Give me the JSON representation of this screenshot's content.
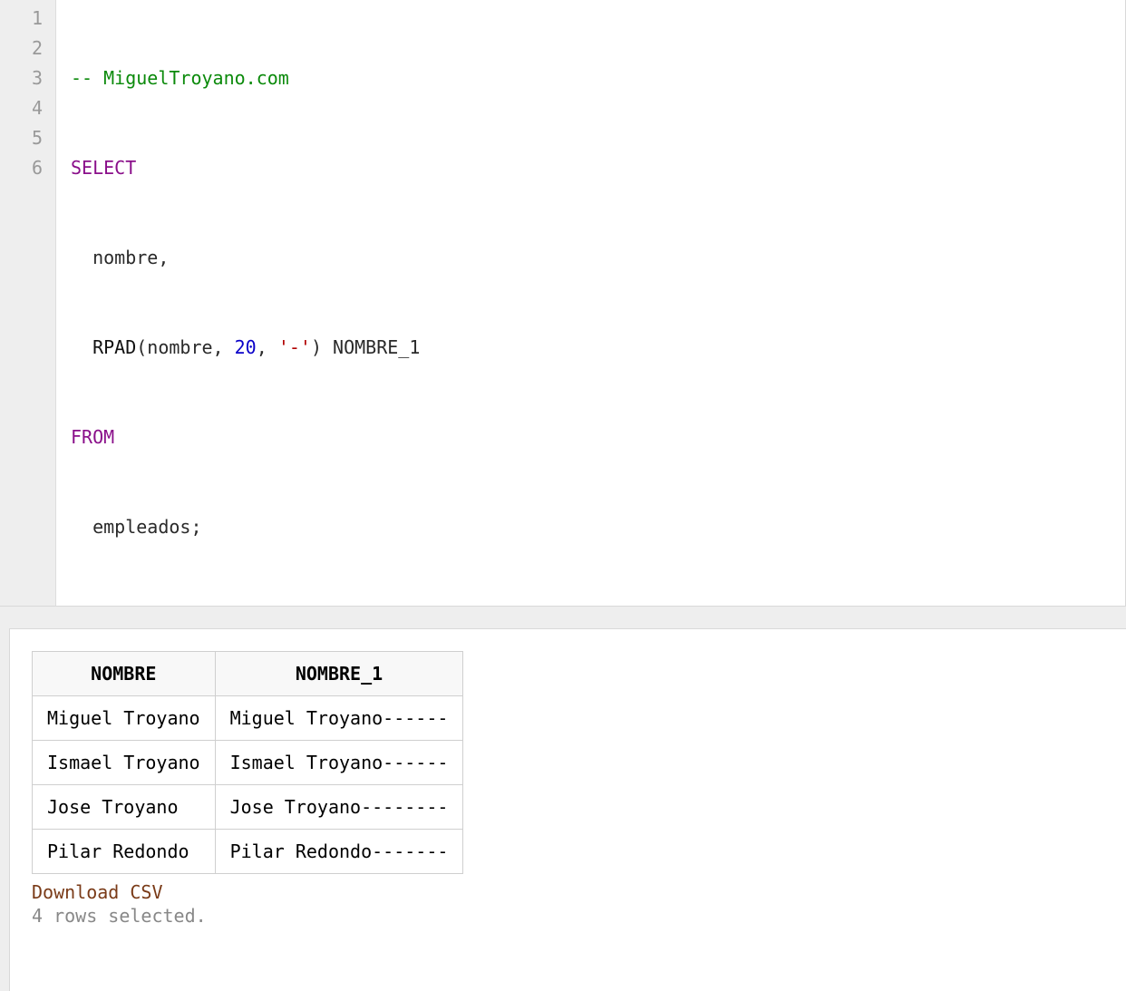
{
  "editor": {
    "lineNumbers": [
      "1",
      "2",
      "3",
      "4",
      "5",
      "6"
    ],
    "code": {
      "l1": {
        "comment": "-- MiguelTroyano.com"
      },
      "l2": {
        "kw": "SELECT"
      },
      "l3": {
        "indent": "  ",
        "text": "nombre,"
      },
      "l4": {
        "indent": "  ",
        "func": "RPAD",
        "open": "(nombre, ",
        "num": "20",
        "mid": ", ",
        "str": "'-'",
        "close": ") NOMBRE_1"
      },
      "l5": {
        "kw": "FROM"
      },
      "l6": {
        "indent": "  ",
        "text": "empleados;"
      }
    }
  },
  "results": {
    "columns": [
      "NOMBRE",
      "NOMBRE_1"
    ],
    "rows": [
      {
        "c0": "Miguel Troyano",
        "c1": "Miguel Troyano------"
      },
      {
        "c0": "Ismael Troyano",
        "c1": "Ismael Troyano------"
      },
      {
        "c0": "Jose Troyano",
        "c1": "Jose Troyano--------"
      },
      {
        "c0": "Pilar Redondo",
        "c1": "Pilar Redondo-------"
      }
    ],
    "downloadLabel": "Download CSV",
    "rowCountLabel": "4 rows selected."
  }
}
